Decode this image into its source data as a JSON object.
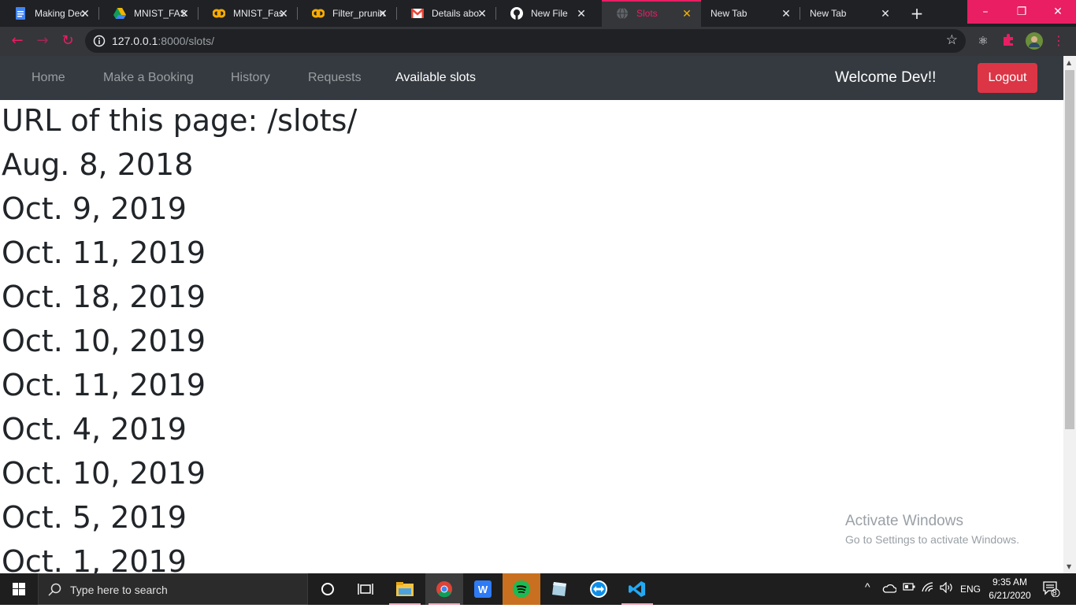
{
  "browser": {
    "tabs": [
      {
        "title": "Making Dec",
        "icon": "google-docs-icon"
      },
      {
        "title": "MNIST_FAS",
        "icon": "google-drive-icon"
      },
      {
        "title": "MNIST_Fas",
        "icon": "colab-icon"
      },
      {
        "title": "Filter_prunin",
        "icon": "colab-icon"
      },
      {
        "title": "Details abo",
        "icon": "gmail-icon"
      },
      {
        "title": "New File",
        "icon": "github-icon"
      },
      {
        "title": "Slots",
        "icon": "globe-icon",
        "active": true
      },
      {
        "title": "New Tab",
        "icon": ""
      },
      {
        "title": "New Tab",
        "icon": ""
      }
    ],
    "new_tab_label": "+",
    "window_controls": {
      "minimize": "–",
      "restore": "❐",
      "close": "✕"
    },
    "address": {
      "host": "127.0.0.1",
      "rest": ":8000/slots/"
    },
    "accent_color": "#e91e63"
  },
  "navbar": {
    "links": [
      "Home",
      "Make a Booking",
      "History",
      "Requests",
      "Available slots"
    ],
    "active_link": "Available slots",
    "welcome": "Welcome Dev!!",
    "logout": "Logout"
  },
  "content": {
    "url_line": "URL of this page: /slots/",
    "slots": [
      "Aug. 8, 2018",
      "Oct. 9, 2019",
      "Oct. 11, 2019",
      "Oct. 18, 2019",
      "Oct. 10, 2019",
      "Oct. 11, 2019",
      "Oct. 4, 2019",
      "Oct. 10, 2019",
      "Oct. 5, 2019",
      "Oct. 1, 2019"
    ]
  },
  "watermark": {
    "title": "Activate Windows",
    "subtitle": "Go to Settings to activate Windows."
  },
  "taskbar": {
    "search_placeholder": "Type here to search",
    "language": "ENG",
    "time": "9:35 AM",
    "date": "6/21/2020",
    "notification_count": "8"
  }
}
